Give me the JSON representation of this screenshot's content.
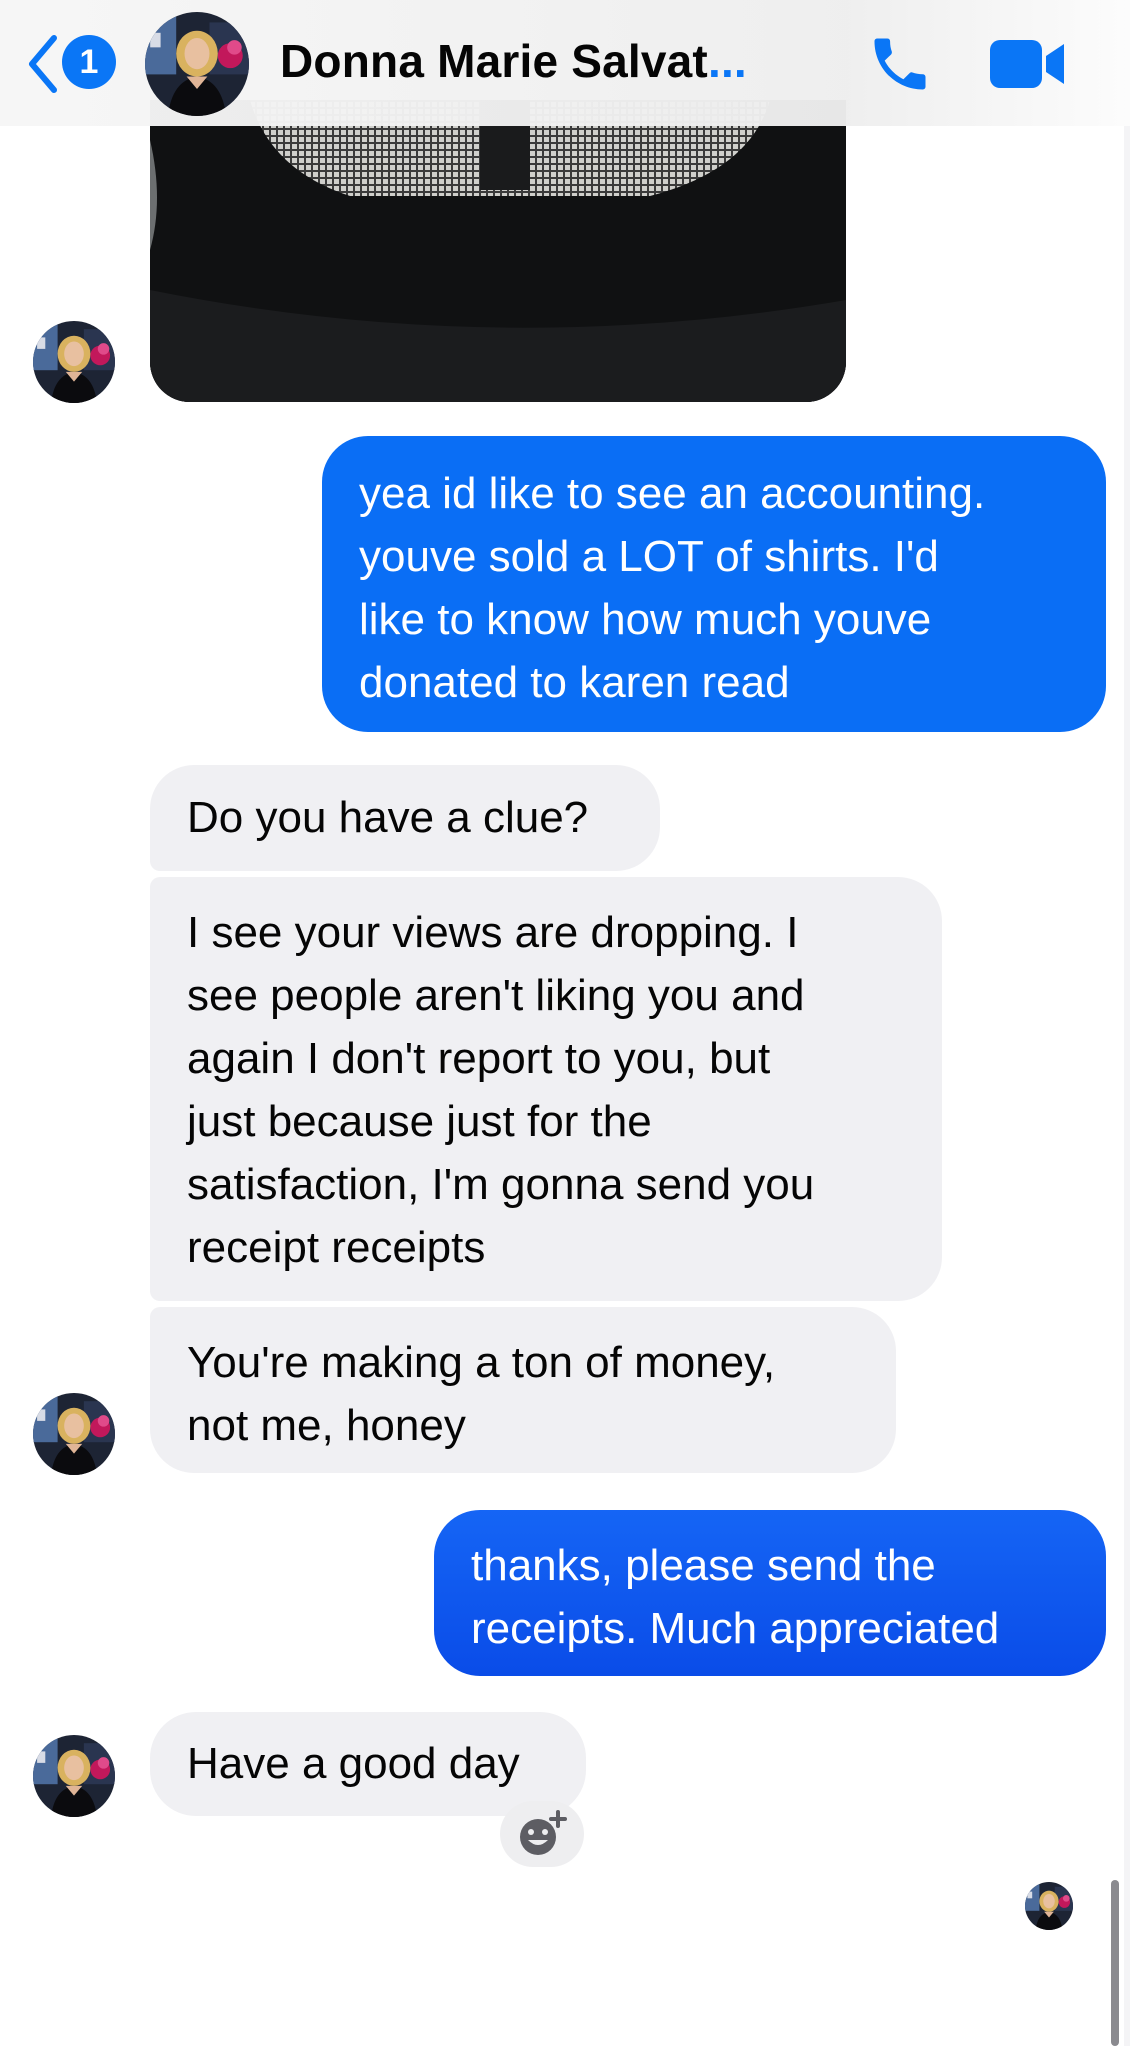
{
  "header": {
    "back_badge_count": "1",
    "contact_name": "Donna Marie Salvat",
    "name_ellipsis": "...",
    "accent_color": "#0a76f6",
    "icons": [
      "chevron-left-icon",
      "phone-icon",
      "video-camera-icon"
    ]
  },
  "messages": [
    {
      "direction": "incoming",
      "type": "photo"
    },
    {
      "direction": "outgoing",
      "lines": [
        "yea id like to see an accounting.",
        "youve sold a LOT of shirts. I'd",
        "like to know how much youve",
        "donated to karen read"
      ]
    },
    {
      "direction": "incoming",
      "lines": [
        "Do you have a clue?"
      ]
    },
    {
      "direction": "incoming",
      "lines": [
        "I see your views are dropping. I",
        "see people aren't liking you and",
        "again I don't report to you, but",
        "just because just for the",
        "satisfaction, I'm gonna send you",
        "receipt receipts"
      ]
    },
    {
      "direction": "incoming",
      "lines": [
        "You're making a ton of money,",
        "not me, honey"
      ]
    },
    {
      "direction": "outgoing",
      "lines": [
        "thanks, please send the",
        "receipts. Much appreciated"
      ]
    },
    {
      "direction": "incoming",
      "lines": [
        "Have a good day"
      ]
    }
  ],
  "react_icon": "add-reaction-icon",
  "colors": {
    "outgoing_bubble": "#0a6ef5",
    "outgoing_bubble_latest": "#0a4ce8",
    "incoming_bubble": "#f0f0f3"
  }
}
